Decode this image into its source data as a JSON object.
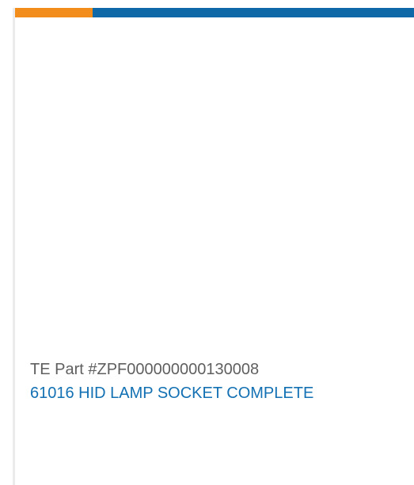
{
  "colors": {
    "accent_orange": "#f28d1b",
    "accent_blue": "#0f68a8",
    "product_link": "#1270b3",
    "part_text": "#5f5f5f"
  },
  "product": {
    "part_number_label": "TE Part #ZPF000000000130008",
    "name": "61016 HID LAMP SOCKET COMPLETE"
  }
}
